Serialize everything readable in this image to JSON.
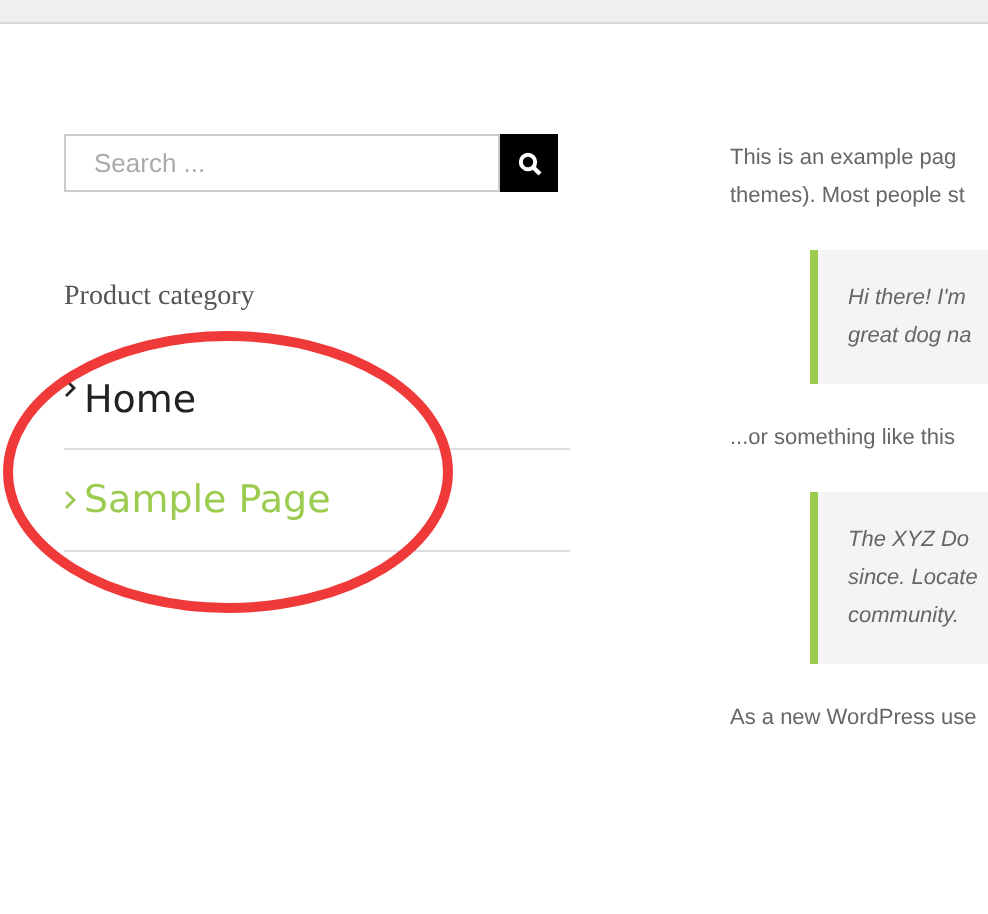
{
  "search": {
    "placeholder": "Search ..."
  },
  "sidebar": {
    "heading": "Product category",
    "items": [
      {
        "label": "Home",
        "current": false
      },
      {
        "label": "Sample Page",
        "current": true
      }
    ]
  },
  "content": [
    {
      "kind": "paragraph",
      "lines": [
        "This is an example pag",
        "themes). Most people st"
      ]
    },
    {
      "kind": "quote",
      "lines": [
        "Hi there! I'm",
        "great dog na"
      ]
    },
    {
      "kind": "paragraph",
      "lines": [
        "...or something like this"
      ]
    },
    {
      "kind": "quote",
      "lines": [
        "The XYZ Do",
        "since. Locate",
        "community."
      ]
    },
    {
      "kind": "paragraph",
      "lines": [
        "As a new WordPress use"
      ]
    }
  ]
}
